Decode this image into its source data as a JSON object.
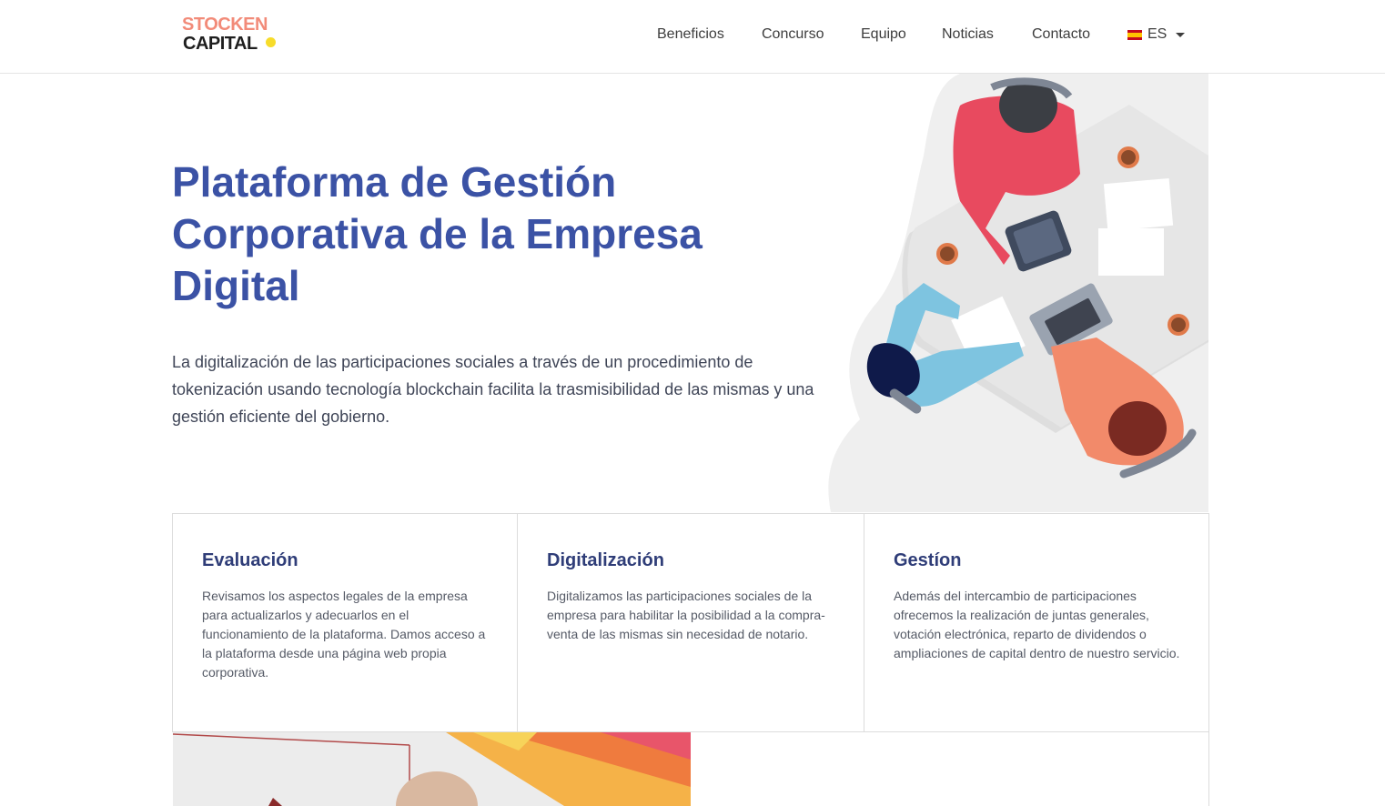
{
  "header": {
    "logo_top": "STOCKEN",
    "logo_bottom": "CAPITAL",
    "nav": [
      {
        "label": "Beneficios"
      },
      {
        "label": "Concurso"
      },
      {
        "label": "Equipo"
      },
      {
        "label": "Noticias"
      },
      {
        "label": "Contacto"
      }
    ],
    "language": {
      "label": "ES",
      "flag_icon": "spain-flag-icon"
    }
  },
  "hero": {
    "title": "Plataforma de Gestión Corporativa de la Empresa Digital",
    "text": "La digitalización de las participaciones sociales a través de un procedimiento de tokenización usando tecnología blockchain facilita la trasmisibilidad de las mismas y una gestión eficiente del gobierno."
  },
  "features": [
    {
      "title": "Evaluación",
      "text": "Revisamos los aspectos legales de la empresa para actualizarlos y adecuarlos en el funcionamiento de la plataforma. Damos acceso a la plataforma desde una página web propia corporativa."
    },
    {
      "title": "Digitalización",
      "text": "Digitalizamos las participaciones sociales de la empresa para habilitar la posibilidad a la compra-venta de las mismas sin necesidad de notario."
    },
    {
      "title": "Gestíon",
      "text": "Además del intercambio de participaciones ofrecemos la realización de juntas generales, votación electrónica, reparto de dividendos o ampliaciones de capital dentro de nuestro servicio."
    }
  ],
  "colors": {
    "brand_blue": "#3b52a5",
    "logo_salmon": "#f28b79",
    "logo_dot": "#f7dc2a"
  }
}
